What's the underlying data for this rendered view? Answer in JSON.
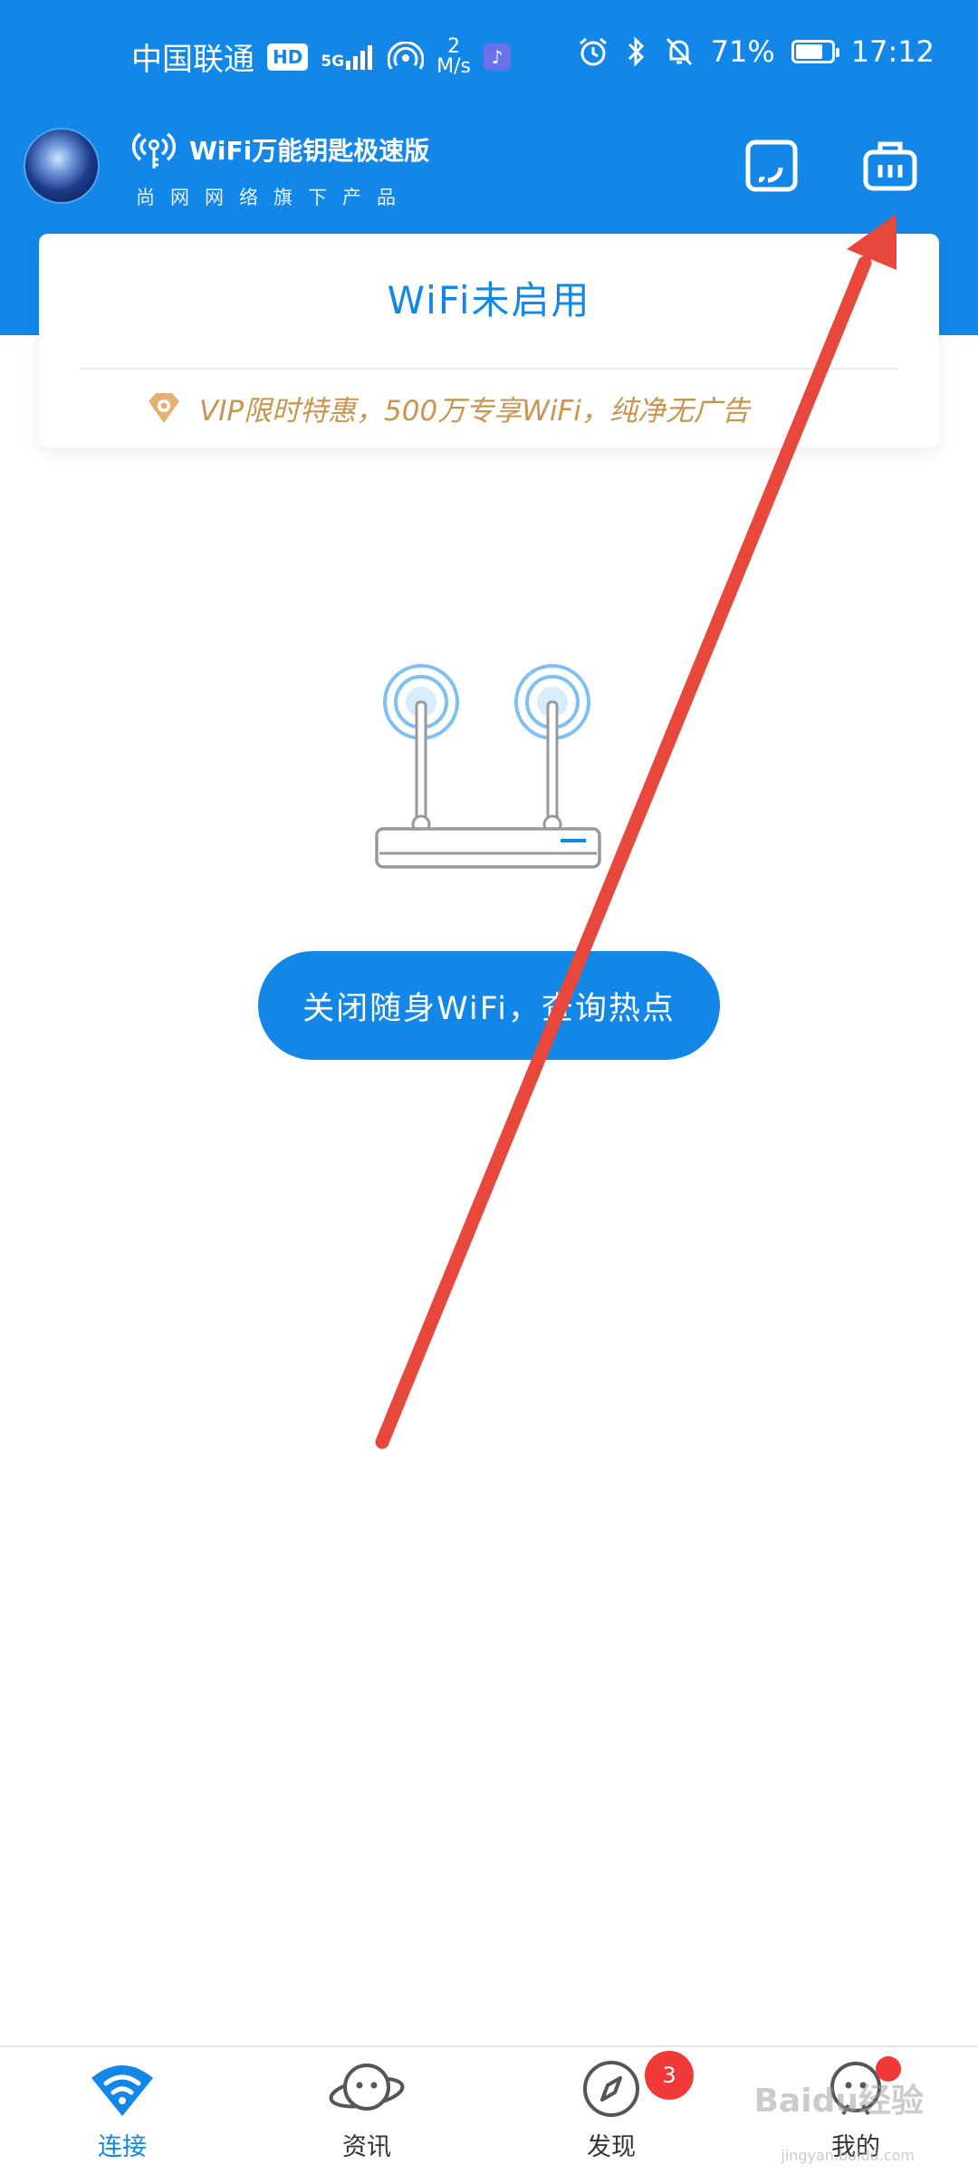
{
  "status_bar": {
    "carrier": "中国联通",
    "hd": "HD",
    "network": "5G",
    "speed_value": "2",
    "speed_unit": "M/s",
    "battery": "71%",
    "time": "17:12"
  },
  "header": {
    "app_title": "WiFi万能钥匙极速版",
    "app_subtitle": "尚网网络旗下产品"
  },
  "card": {
    "status": "WiFi未启用",
    "vip_promo": "VIP限时特惠，500万专享WiFi，纯净无广告"
  },
  "main": {
    "button_label": "关闭随身WiFi，查询热点"
  },
  "bottom_nav": {
    "items": [
      {
        "label": "连接",
        "active": true
      },
      {
        "label": "资讯"
      },
      {
        "label": "发现",
        "badge": "3"
      },
      {
        "label": "我的"
      }
    ]
  },
  "watermark": {
    "brand": "Baidu经验",
    "url": "jingyan.baidu.com"
  },
  "colors": {
    "primary": "#1287e8",
    "vip_gold": "#c8944e",
    "badge_red": "#f03a3a",
    "annotation_red": "#e8483c"
  }
}
